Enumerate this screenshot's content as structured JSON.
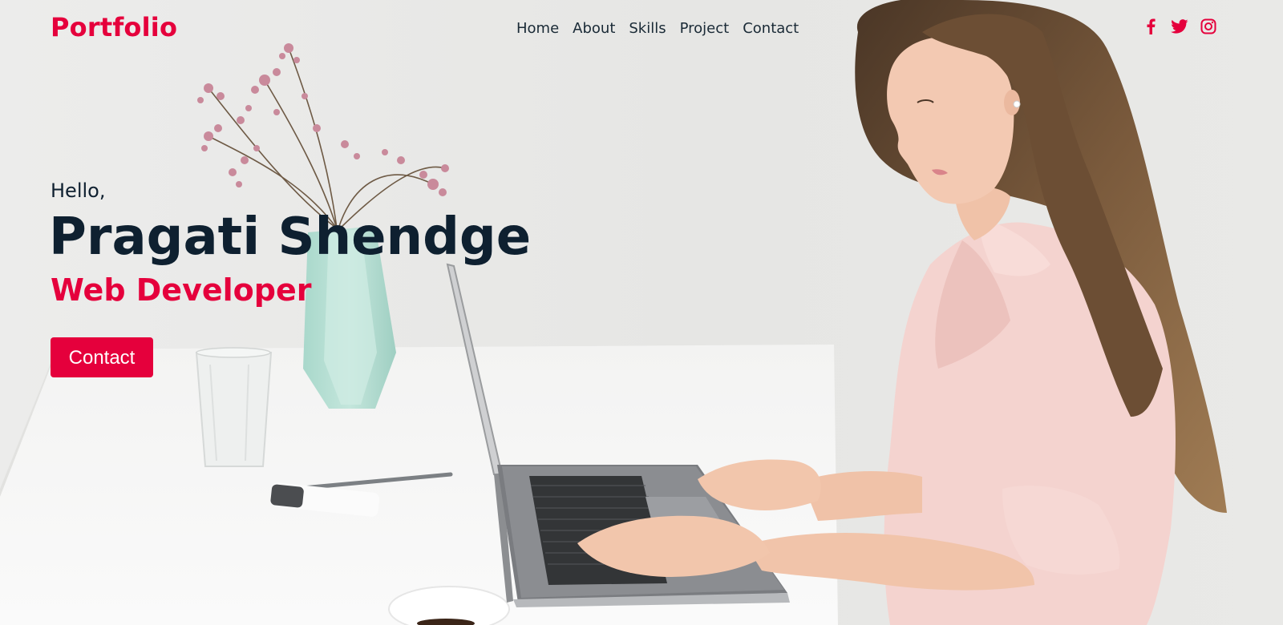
{
  "header": {
    "logo": "Portfolio",
    "nav": [
      {
        "label": "Home"
      },
      {
        "label": "About"
      },
      {
        "label": "Skills"
      },
      {
        "label": "Project"
      },
      {
        "label": "Contact"
      }
    ],
    "social": [
      {
        "icon": "facebook-icon"
      },
      {
        "icon": "twitter-icon"
      },
      {
        "icon": "instagram-icon"
      }
    ]
  },
  "hero": {
    "greeting": "Hello,",
    "name": "Pragati Shendge",
    "role": "Web Developer",
    "cta_label": "Contact"
  },
  "colors": {
    "accent": "#e5003c",
    "text_dark": "#0e2030",
    "background": "#e9e9e7"
  }
}
